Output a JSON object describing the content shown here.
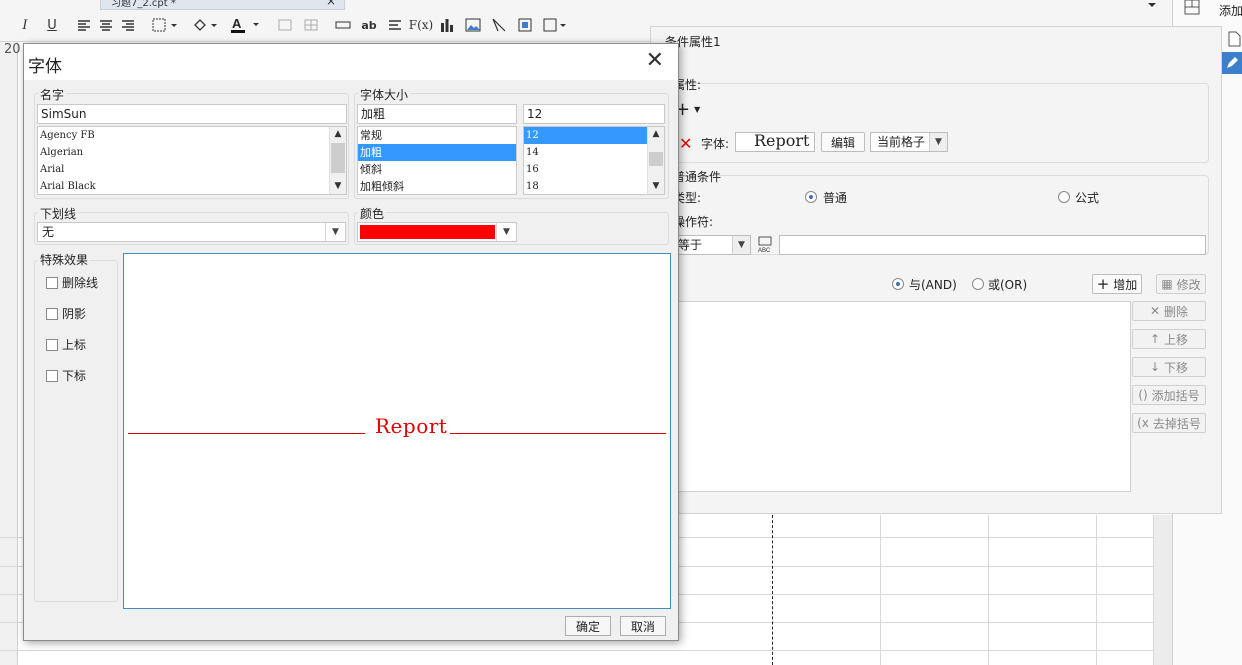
{
  "tab": {
    "title": "习题7_2.cpt *",
    "close": "×"
  },
  "toolbar": {
    "italic": "I",
    "underline": "U",
    "fx": "F(x)",
    "ab": "ab",
    "row_number": "20"
  },
  "cond_panel": {
    "title": "条件属性1",
    "attr_label": "属性:",
    "add_symbol": "+",
    "font_label": "字体:",
    "font_preview": "Report",
    "edit_button": "编辑",
    "scope_value": "当前格子",
    "normal_cond_label": "普通条件",
    "type_label": "类型:",
    "type_normal": "普通",
    "type_formula": "公式",
    "operator_label": "操作符:",
    "operator_value": "等于",
    "and_label": "与(AND)",
    "or_label": "或(OR)",
    "add_button": "增加",
    "modify_button": "修改",
    "delete_button": "删除",
    "up_button": "上移",
    "down_button": "下移",
    "add_bracket_button": "添加括号",
    "remove_bracket_button": "去掉括号"
  },
  "right_strip": {
    "add_label": "添加"
  },
  "dialog": {
    "title": "字体",
    "name_label": "名字",
    "name_value": "SimSun",
    "fonts": [
      "Agency FB",
      "Algerian",
      "Arial",
      "Arial Black"
    ],
    "size_group_label": "字体大小",
    "style_value": "加粗",
    "styles": [
      "常规",
      "加粗",
      "倾斜",
      "加粗倾斜"
    ],
    "selected_style": "加粗",
    "size_value": "12",
    "sizes": [
      "12",
      "14",
      "16",
      "18"
    ],
    "selected_size": "12",
    "underline_label": "下划线",
    "underline_value": "无",
    "color_label": "颜色",
    "color_value": "#ff0000",
    "effects_label": "特殊效果",
    "effects": [
      "删除线",
      "阴影",
      "上标",
      "下标"
    ],
    "preview_text": "Report",
    "ok_button": "确定",
    "cancel_button": "取消"
  }
}
